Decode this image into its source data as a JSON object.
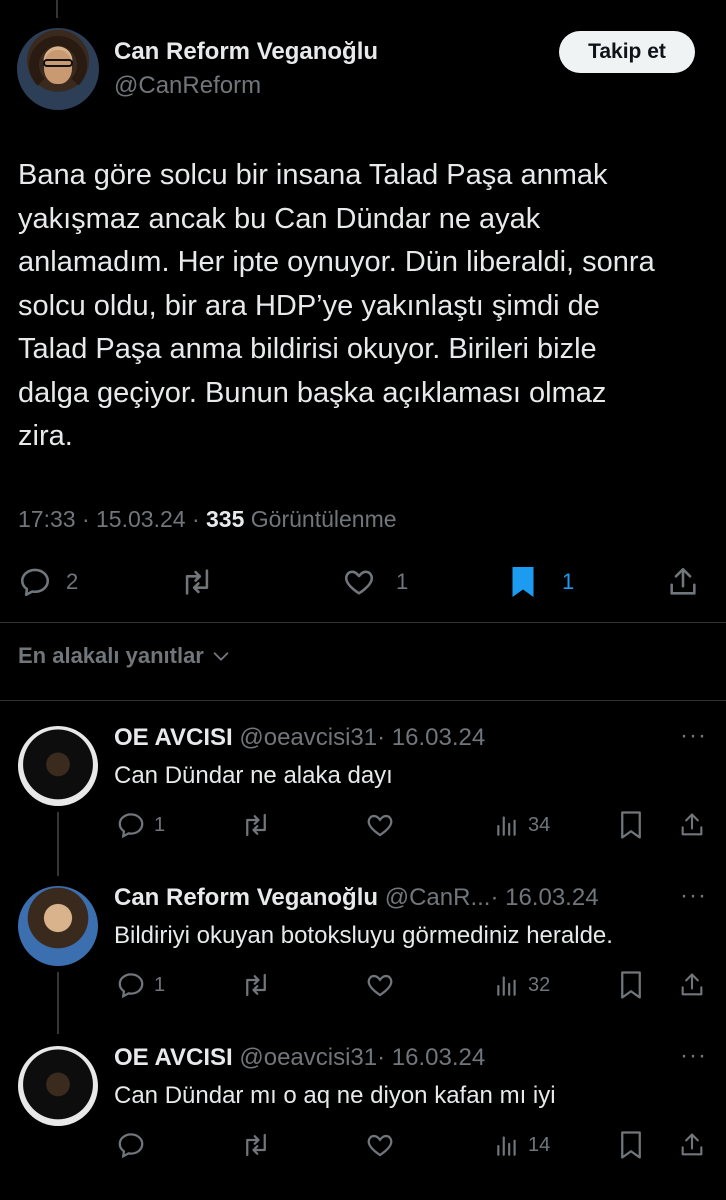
{
  "tweet": {
    "author_name": "Can Reform Veganoğlu",
    "author_handle": "@CanReform",
    "follow_label": "Takip et",
    "text": "Bana göre solcu bir insana Talad Paşa anmak\nyakışmaz  ancak bu Can Dündar ne ayak\nanlamadım. Her ipte oynuyor. Dün liberaldi, sonra\nsolcu oldu, bir ara HDP’ye yakınlaştı şimdi de\nTalad Paşa anma bildirisi okuyor. Birileri bizle\ndalga geçiyor. Bunun başka açıklaması olmaz\nzira.",
    "time": "17:33",
    "date": "15.03.24",
    "views_count": "335",
    "views_label": "Görüntülenme",
    "replies": "2",
    "likes": "1",
    "bookmarks": "1",
    "bookmark_color": "#1d9bf0"
  },
  "sort_label": "En alakalı yanıtlar",
  "replies": [
    {
      "name": "OE AVCISI",
      "handle": "@oeavcisi31",
      "date": "· 16.03.24",
      "text": "Can Dündar ne alaka dayı",
      "reply_count": "1",
      "views": "34",
      "more": "···"
    },
    {
      "name": "Can Reform Veganoğlu",
      "handle": "@CanR...",
      "date": "· 16.03.24",
      "text": "Bildiriyi okuyan botoksluyu görmediniz heralde.",
      "reply_count": "1",
      "views": "32",
      "more": "···"
    },
    {
      "name": "OE AVCISI",
      "handle": "@oeavcisi31",
      "date": "· 16.03.24",
      "text": "Can Dündar mı o aq ne diyon kafan mı iyi",
      "reply_count": "",
      "views": "14",
      "more": "···"
    }
  ]
}
